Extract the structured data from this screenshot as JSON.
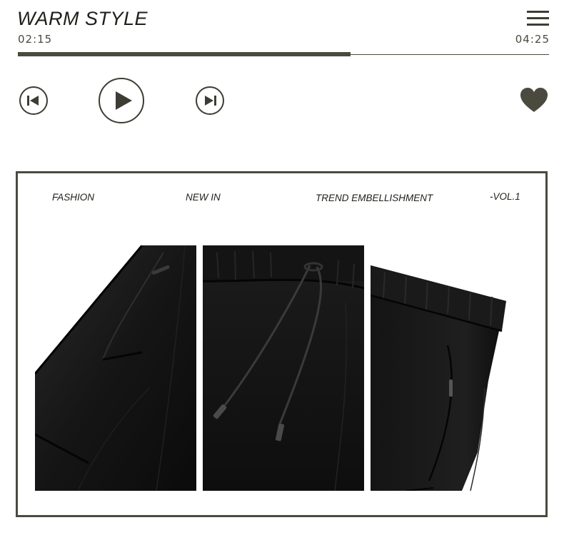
{
  "player": {
    "title": "WARM STYLE",
    "current_time": "02:15",
    "total_time": "04:25",
    "progress": 0.627,
    "accent_color": "#4b4a3f"
  },
  "controls": {
    "prev_icon": "skip-previous-icon",
    "play_icon": "play-icon",
    "next_icon": "skip-next-icon",
    "favorite_icon": "heart-icon",
    "menu_icon": "hamburger-menu-icon"
  },
  "banner": {
    "tags": [
      "FASHION",
      "NEW IN",
      "TREND EMBELLISHMENT",
      "-VOL.1"
    ],
    "images": [
      "pants-side-pocket-photo",
      "pants-drawstring-waist-photo",
      "pants-elastic-waist-photo"
    ]
  }
}
